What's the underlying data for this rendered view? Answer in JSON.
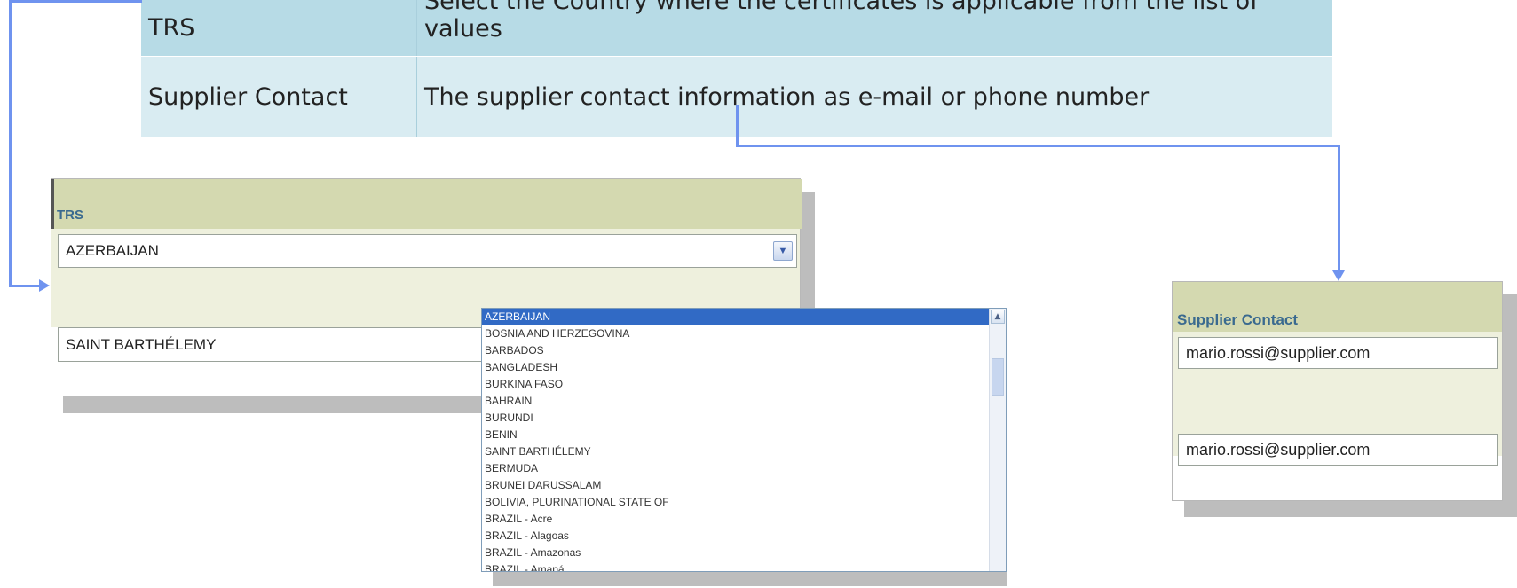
{
  "doc_table": {
    "rows": [
      {
        "term": "TRS",
        "description": "Select the Country where the certificates is applicable from the list of values"
      },
      {
        "term": "Supplier Contact",
        "description": "The supplier contact information as e-mail or phone number"
      }
    ]
  },
  "trs_panel": {
    "header": "TRS",
    "select_value": "AZERBAIJAN",
    "second_value": "SAINT BARTHÉLEMY"
  },
  "country_list": {
    "options": [
      "AZERBAIJAN",
      "BOSNIA AND HERZEGOVINA",
      "BARBADOS",
      "BANGLADESH",
      "BURKINA FASO",
      "BAHRAIN",
      "BURUNDI",
      "BENIN",
      "SAINT BARTHÉLEMY",
      "BERMUDA",
      "BRUNEI DARUSSALAM",
      "BOLIVIA, PLURINATIONAL STATE OF",
      "BRAZIL - Acre",
      "BRAZIL - Alagoas",
      "BRAZIL - Amazonas",
      "BRAZIL - Amapá"
    ],
    "selected_index": 0
  },
  "supplier_panel": {
    "header": "Supplier Contact",
    "field_value": "mario.rossi@supplier.com",
    "second_value": "mario.rossi@supplier.com"
  },
  "colors": {
    "connector": "#6f93ef",
    "table_header_row": "#b7dbe6",
    "table_row": "#d9ecf2",
    "panel_header": "#d4d9b0",
    "panel_label": "#3a6a8f",
    "selected_option": "#316ac5"
  },
  "icons": {
    "dropdown_arrow": "chevron-down-icon",
    "scroll_up": "chevron-up-icon"
  }
}
